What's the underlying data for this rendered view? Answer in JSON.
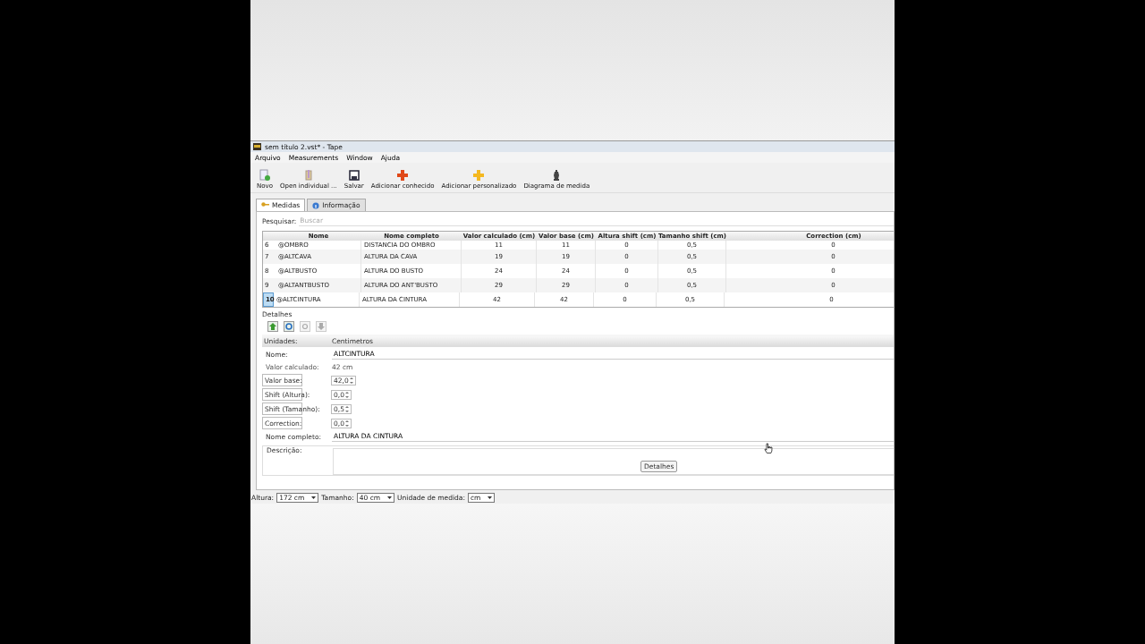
{
  "window": {
    "title": "sem título 2.vst* - Tape"
  },
  "menu": [
    "Arquivo",
    "Measurements",
    "Window",
    "Ajuda"
  ],
  "toolbar": [
    {
      "kind": "new",
      "label": "Novo"
    },
    {
      "kind": "open",
      "label": "Open individual ..."
    },
    {
      "kind": "save",
      "label": "Salvar"
    },
    {
      "kind": "add-red",
      "label": "Adicionar conhecido"
    },
    {
      "kind": "add-yellow",
      "label": "Adicionar personalizado"
    },
    {
      "kind": "figure",
      "label": "Diagrama de medida"
    }
  ],
  "tabs": [
    {
      "kind": "key",
      "label": "Medidas",
      "selected": true
    },
    {
      "kind": "info",
      "label": "Informação",
      "selected": false
    }
  ],
  "search": {
    "label": "Pesquisar:",
    "placeholder": "Buscar"
  },
  "table": {
    "columns": [
      "Nome",
      "Nome completo",
      "Valor calculado (cm)",
      "Valor base (cm)",
      "Altura shift (cm)",
      "Tamanho shift (cm)",
      "Correction (cm)"
    ],
    "rows": [
      {
        "number": "6",
        "cells": [
          "@OMBRO",
          "DISTANCIA DO OMBRO",
          "11",
          "11",
          "0",
          "0,5",
          "0"
        ],
        "selected": false
      },
      {
        "number": "7",
        "cells": [
          "@ALTCAVA",
          "ALTURA DA CAVA",
          "19",
          "19",
          "0",
          "0,5",
          "0"
        ],
        "selected": false
      },
      {
        "number": "8",
        "cells": [
          "@ALTBUSTO",
          "ALTURA DO BUSTO",
          "24",
          "24",
          "0",
          "0,5",
          "0"
        ],
        "selected": false
      },
      {
        "number": "9",
        "cells": [
          "@ALTANTBUSTO",
          "ALTURA DO ANT'BUSTO",
          "29",
          "29",
          "0",
          "0,5",
          "0"
        ],
        "selected": false
      },
      {
        "number": "10",
        "cells": [
          "@ALTCINTURA",
          "ALTURA DA CINTURA",
          "42",
          "42",
          "0",
          "0,5",
          "0"
        ],
        "selected": true
      }
    ]
  },
  "details": {
    "title": "Detalhes",
    "tools": [
      {
        "kind": "up",
        "disabled": false
      },
      {
        "kind": "refresh",
        "disabled": false
      },
      {
        "kind": "circle",
        "disabled": true
      },
      {
        "kind": "down",
        "disabled": true
      }
    ],
    "fields": [
      {
        "kind": "combo",
        "label": "Unidades:",
        "value": "Centimetros"
      },
      {
        "kind": "text",
        "label": "Nome:",
        "value": "ALTCINTURA"
      },
      {
        "kind": "readout",
        "label": "Valor calculado:",
        "value": "42 cm"
      },
      {
        "kind": "spin",
        "label": "Valor base:",
        "value": "42,0"
      },
      {
        "kind": "spin",
        "label": "Shift (Altura):",
        "value": "0,0"
      },
      {
        "kind": "spin",
        "label": "Shift (Tamanho):",
        "value": "0,5"
      },
      {
        "kind": "spin",
        "label": "Correction:",
        "value": "0,0"
      },
      {
        "kind": "text",
        "label": "Nome completo:",
        "value": "ALTURA DA CINTURA"
      },
      {
        "kind": "area",
        "label": "Descrição:",
        "button": "Detalhes"
      }
    ]
  },
  "status_bar": [
    {
      "label": "Altura:",
      "value": "172 cm"
    },
    {
      "label": "Tamanho:",
      "value": "40 cm"
    },
    {
      "label": "Unidade de medida:",
      "value": "cm"
    }
  ]
}
